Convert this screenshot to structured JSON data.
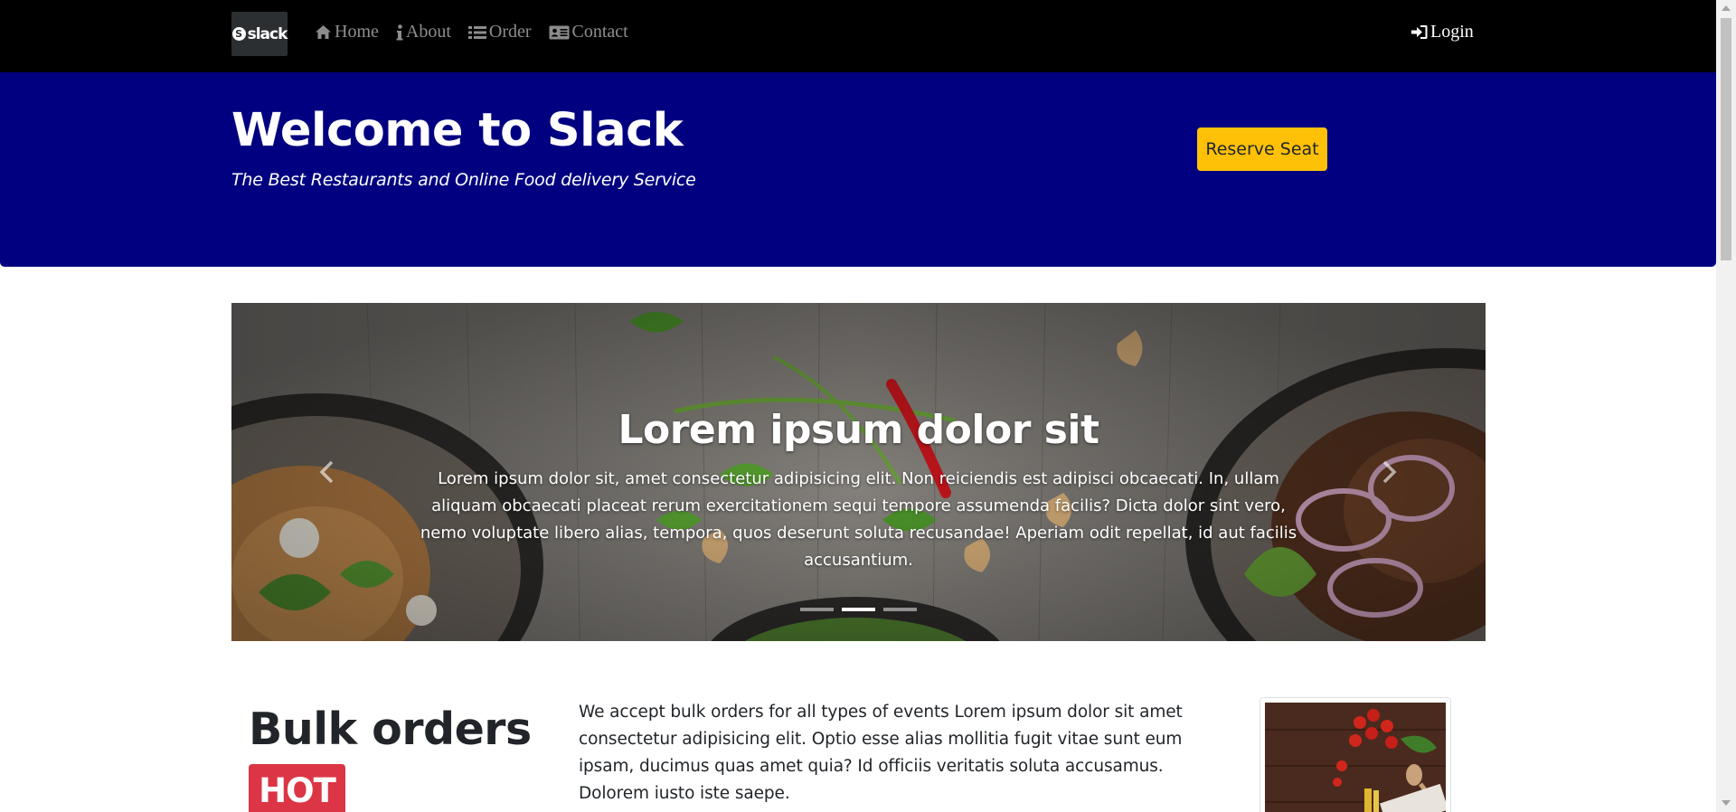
{
  "navbar": {
    "brand": {
      "logo_text": "slack",
      "logo_mark": "S"
    },
    "links": [
      {
        "label": "Home",
        "icon": "home-icon"
      },
      {
        "label": "About",
        "icon": "info-icon"
      },
      {
        "label": "Order",
        "icon": "list-icon"
      },
      {
        "label": "Contact",
        "icon": "contact-card-icon"
      }
    ],
    "login": {
      "label": "Login",
      "icon": "login-icon"
    }
  },
  "hero": {
    "title": "Welcome to Slack",
    "subtitle": "The Best Restaurants and Online Food delivery Service",
    "reserve_button": "Reserve Seat"
  },
  "carousel": {
    "caption_title": "Lorem ipsum dolor sit",
    "caption_text": "Lorem ipsum dolor sit, amet consectetur adipisicing elit. Non reiciendis est adipisci obcaecati. In, ullam aliquam obcaecati placeat rerum exercitationem sequi tempore assumenda facilis? Dicta dolor sint vero, nemo voluptate libero alias, tempora, quos deserunt soluta recusandae! Aperiam odit repellat, id aut facilis accusantium.",
    "indicators_count": 3,
    "active_indicator": 1
  },
  "bulk": {
    "title": "Bulk orders",
    "badge": "HOT",
    "text": "We accept bulk orders for all types of events Lorem ipsum dolor sit amet consectetur adipisicing elit. Optio esse alias mollitia fugit vitae sunt eum ipsam, ducimus quas amet quia? Id officiis veritatis soluta accusamus. Dolorem iusto iste saepe."
  },
  "colors": {
    "navbar_bg": "#000000",
    "hero_bg": "#000080",
    "reserve_button": "#ffc107",
    "hot_badge": "#dc3545"
  }
}
